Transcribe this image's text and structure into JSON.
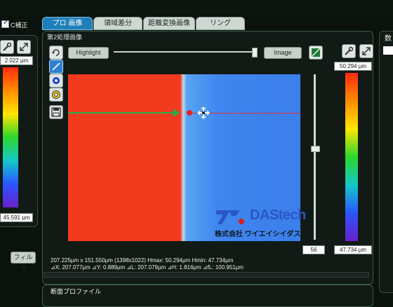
{
  "left_panel": {
    "checkbox_label": "C補正",
    "top_value": "2.022 µm",
    "bottom_value": "45.591 µm",
    "filter_button": "フィルタ"
  },
  "tabs": [
    "プロ 画像",
    "領域差分",
    "距離変換画像",
    "リング"
  ],
  "active_tab": 0,
  "viewer": {
    "title": "第2処理画像",
    "highlight_label": "Highlight",
    "image_label": "Image",
    "slider_value": "56"
  },
  "right_scale": {
    "top_value": "50.294 µm",
    "bottom_value": "47.734 µm"
  },
  "watermark": {
    "logo_text": "DAStech",
    "company": "株式会社 ワイエイシイダステック"
  },
  "info": {
    "line1": "207.225μm x 151.550μm (1398x1022) Hmax: 50.294μm Hmin: 47.734μm",
    "line2": "⊿X: 207.077μm ⊿Y: 0.889μm ⊿L: 207.079μm ⊿H: 1.816μm ⊿fL: 100.951μm"
  },
  "profile_title": "断面プロファイル",
  "right_edge_label": "数",
  "colors": {
    "red_area": "#f23a1e",
    "blue_area": "#3f86ef",
    "green_line": "#22b14c",
    "tab_active": "#1f7fb8"
  }
}
